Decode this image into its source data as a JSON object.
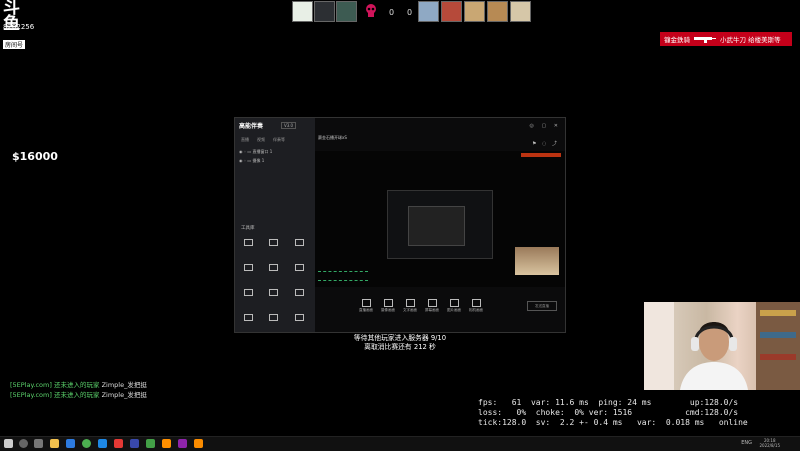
{
  "header": {
    "logo_text": "斗鱼",
    "logo_sub": "房间号",
    "room_id": "8202256"
  },
  "scoreboard": {
    "left_score": "0",
    "right_score": "0",
    "skull_color": "#d0145a",
    "left_players": 3,
    "right_players": 5
  },
  "badge": {
    "prefix": "镰金鉄骑",
    "gun_icon": "gun-icon",
    "name": "小武牛刀 给楼美斯等"
  },
  "money": "$16000",
  "client_window": {
    "app_name": "高能伴奏",
    "version": "V3.0",
    "tabs": [
      "直播",
      "视频",
      "伴奏等"
    ],
    "tree_items": [
      "直播窗口 1",
      "摄像 1"
    ],
    "tool_title": "工具库",
    "stream_title": "赛金石播开球xS",
    "controls": [
      "直播画面",
      "摄像画面",
      "文字画面",
      "屏幕画面",
      "图片画面",
      "相机画面"
    ],
    "send_label": "发送直播"
  },
  "status": {
    "line1": "等待其他玩家进入服务器 9/10",
    "line2": "离取消比赛还有 212 秒"
  },
  "chat": [
    {
      "server": "[5EPlay.com]",
      "text": "还未进入的玩家",
      "name": "Zimple_发把挺"
    },
    {
      "server": "[5EPlay.com]",
      "text": "还未进入的玩家",
      "name": "Zimple_发把挺"
    }
  ],
  "netgraph": {
    "line1": "fps:   61  var: 11.6 ms  ping: 24 ms        up:128.0/s",
    "line2": "loss:   0%  choke:  0% ver: 1516           cmd:128.0/s",
    "line3": "tick:128.0  sv:  2.2 +- 0.4 ms   var:  0.018 ms   online"
  },
  "taskbar": {
    "clock_time": "20:18",
    "clock_date": "2022/8/15",
    "lang": "ENG"
  },
  "colors": {
    "badge_red": "#c4001a",
    "chat_green": "#5bd36c"
  }
}
